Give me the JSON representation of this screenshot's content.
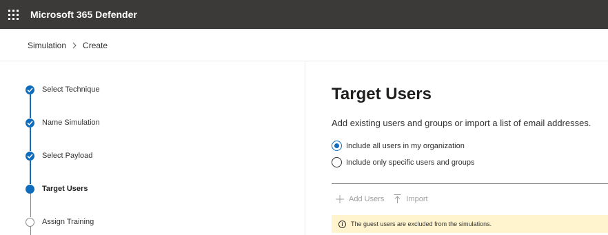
{
  "topbar": {
    "app_title": "Microsoft 365 Defender",
    "waffle_icon": "app-launcher-icon",
    "background": "#3b3a39"
  },
  "breadcrumb": {
    "items": [
      "Simulation",
      "Create"
    ],
    "separator_icon": "chevron-right-icon"
  },
  "wizard": {
    "steps": [
      {
        "label": "Select Technique",
        "state": "completed"
      },
      {
        "label": "Name Simulation",
        "state": "completed"
      },
      {
        "label": "Select Payload",
        "state": "completed"
      },
      {
        "label": "Target Users",
        "state": "current"
      },
      {
        "label": "Assign Training",
        "state": "pending"
      }
    ],
    "accent": "#0f6cbd"
  },
  "main": {
    "title": "Target Users",
    "description": "Add existing users and groups or import a list of email addresses.",
    "options": [
      {
        "label": "Include all users in my organization",
        "selected": true
      },
      {
        "label": "Include only specific users and groups",
        "selected": false
      }
    ],
    "commands": [
      {
        "label": "Add Users",
        "icon": "plus-icon",
        "enabled": false
      },
      {
        "label": "Import",
        "icon": "upload-icon",
        "enabled": false
      }
    ],
    "notice": {
      "icon": "info-icon",
      "text": "The guest users are excluded from the simulations.",
      "background": "#fff4ce"
    }
  }
}
